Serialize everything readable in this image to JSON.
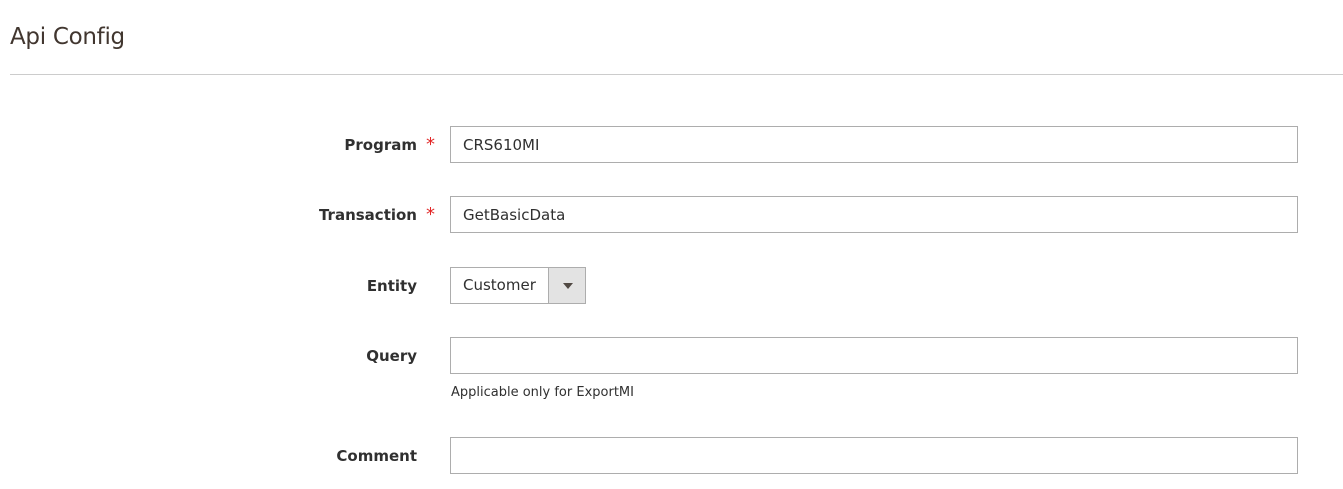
{
  "section": {
    "title": "Api Config"
  },
  "fields": {
    "program": {
      "label": "Program",
      "required_mark": "*",
      "value": "CRS610MI"
    },
    "transaction": {
      "label": "Transaction",
      "required_mark": "*",
      "value": "GetBasicData"
    },
    "entity": {
      "label": "Entity",
      "selected": "Customer",
      "icon": "chevron-down-icon"
    },
    "query": {
      "label": "Query",
      "value": "",
      "note": "Applicable only for ExportMI"
    },
    "comment": {
      "label": "Comment",
      "value": ""
    }
  },
  "colors": {
    "required": "#e22626",
    "border": "#adadad",
    "divider": "#cccccc",
    "select_trigger_bg": "#e3e3e3",
    "text": "#303030"
  }
}
